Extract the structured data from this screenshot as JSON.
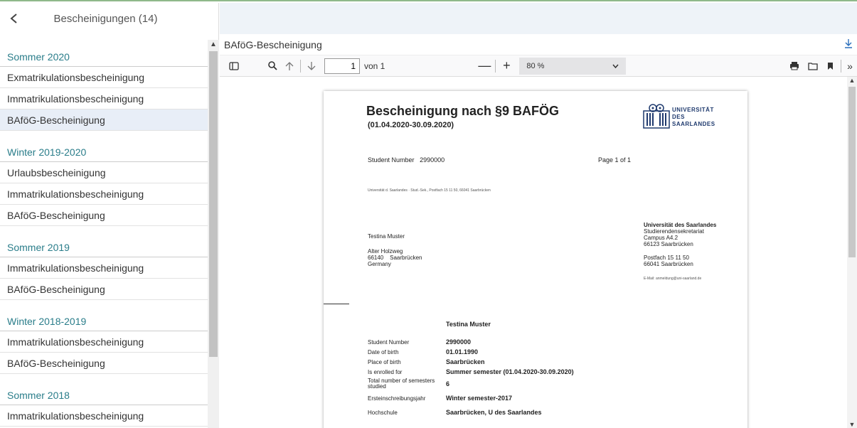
{
  "sidebar": {
    "title": "Bescheinigungen (14)",
    "groups": [
      {
        "title": "Sommer 2020",
        "items": [
          "Exmatrikulationsbescheinigung",
          "Immatrikulationsbescheinigung",
          "BAföG-Bescheinigung"
        ]
      },
      {
        "title": "Winter 2019-2020",
        "items": [
          "Urlaubsbescheinigung",
          "Immatrikulationsbescheinigung",
          "BAföG-Bescheinigung"
        ]
      },
      {
        "title": "Sommer 2019",
        "items": [
          "Immatrikulationsbescheinigung",
          "BAföG-Bescheinigung"
        ]
      },
      {
        "title": "Winter 2018-2019",
        "items": [
          "Immatrikulationsbescheinigung",
          "BAföG-Bescheinigung"
        ]
      },
      {
        "title": "Sommer 2018",
        "items": [
          "Immatrikulationsbescheinigung"
        ]
      }
    ]
  },
  "document": {
    "title": "BAföG-Bescheinigung"
  },
  "toolbar": {
    "page_value": "1",
    "page_of": "von 1",
    "zoom": "80 %"
  },
  "pdf": {
    "title": "Bescheinigung nach §9 BAFÖG",
    "period": "(01.04.2020-30.09.2020)",
    "student_number_label": "Student Number",
    "student_number_value": "2990000",
    "page_info": "Page 1 of 1",
    "sender_line": "Universität d. Saarlandes · Stud.-Sek., Postfach 15 11 50, 66041 Saarbrücken",
    "logo": [
      "UNIVERSITÄT",
      "DES",
      "SAARLANDES"
    ],
    "recipient": [
      "Testina Muster",
      "Alter Holzweg",
      "66140    Saarbrücken",
      "Germany"
    ],
    "uni_block": [
      "Universität des Saarlandes",
      "Studierendensekretariat",
      "Campus A4.2",
      "66123 Saarbrücken",
      "Postfach 15 11 50",
      "66041 Saarbrücken",
      "E-Mail: anmeldung@uni-saarland.de"
    ],
    "name_heading": "Testina Muster",
    "fields": [
      {
        "label": "Student Number",
        "value": "2990000"
      },
      {
        "label": "Date of birth",
        "value": "01.01.1990"
      },
      {
        "label": "Place of birth",
        "value": "Saarbrücken"
      },
      {
        "label": "Is enrolled for",
        "value": "Summer semester (01.04.2020-30.09.2020)"
      },
      {
        "label": "Total number of semesters studied",
        "value": "6"
      },
      {
        "label": "Ersteinschreibungsjahr",
        "value": "Winter semester-2017"
      },
      {
        "label": "Hochschule",
        "value": "Saarbrücken, U des Saarlandes"
      }
    ]
  }
}
